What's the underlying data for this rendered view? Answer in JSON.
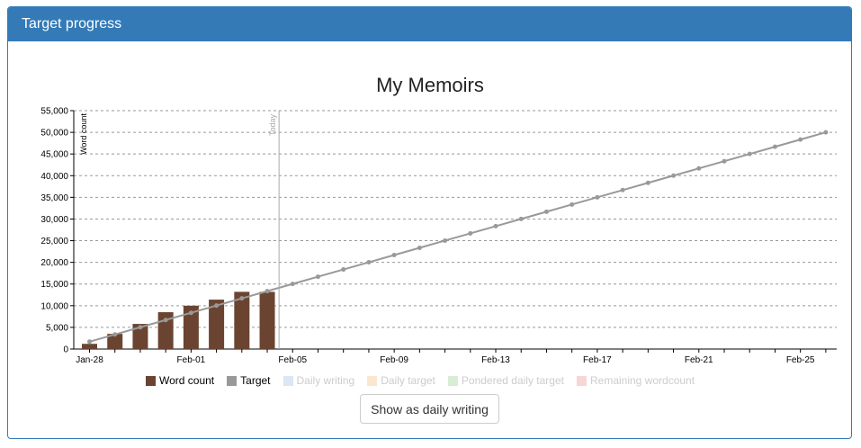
{
  "panel": {
    "title": "Target progress"
  },
  "button": {
    "label": "Show as daily writing"
  },
  "legend": [
    {
      "label": "Word count",
      "color": "#6b4431",
      "active": true
    },
    {
      "label": "Target",
      "color": "#999999",
      "active": true
    },
    {
      "label": "Daily writing",
      "color": "#dbe7f3",
      "active": false
    },
    {
      "label": "Daily target",
      "color": "#fbe6cf",
      "active": false
    },
    {
      "label": "Pondered daily target",
      "color": "#d9ecd6",
      "active": false
    },
    {
      "label": "Remaining wordcount",
      "color": "#f6d6d6",
      "active": false
    }
  ],
  "chart_data": {
    "type": "bar",
    "title": "My Memoirs",
    "ylabel": "Word count",
    "ylim": [
      0,
      55000
    ],
    "yticks": [
      "0",
      "5,000",
      "10,000",
      "15,000",
      "20,000",
      "25,000",
      "30,000",
      "35,000",
      "40,000",
      "45,000",
      "50,000",
      "55,000"
    ],
    "xtick_labels": [
      "Jan-28",
      "Feb-01",
      "Feb-05",
      "Feb-09",
      "Feb-13",
      "Feb-17",
      "Feb-21",
      "Feb-25"
    ],
    "today_label": "Today",
    "today_date": "Feb-04",
    "grid": true,
    "legend_position": "bottom",
    "series": [
      {
        "name": "Word count",
        "color": "#6b4431",
        "dates": [
          "Jan-28",
          "Jan-29",
          "Jan-30",
          "Jan-31",
          "Feb-01",
          "Feb-02",
          "Feb-03",
          "Feb-04"
        ],
        "values": [
          1200,
          3500,
          5800,
          8500,
          10000,
          11400,
          13200,
          13200
        ]
      },
      {
        "name": "Target",
        "color": "#999999",
        "start_date": "Jan-28",
        "end_date": "Feb-26",
        "start_value": 1700,
        "end_value": 50000,
        "points": 30
      }
    ]
  }
}
